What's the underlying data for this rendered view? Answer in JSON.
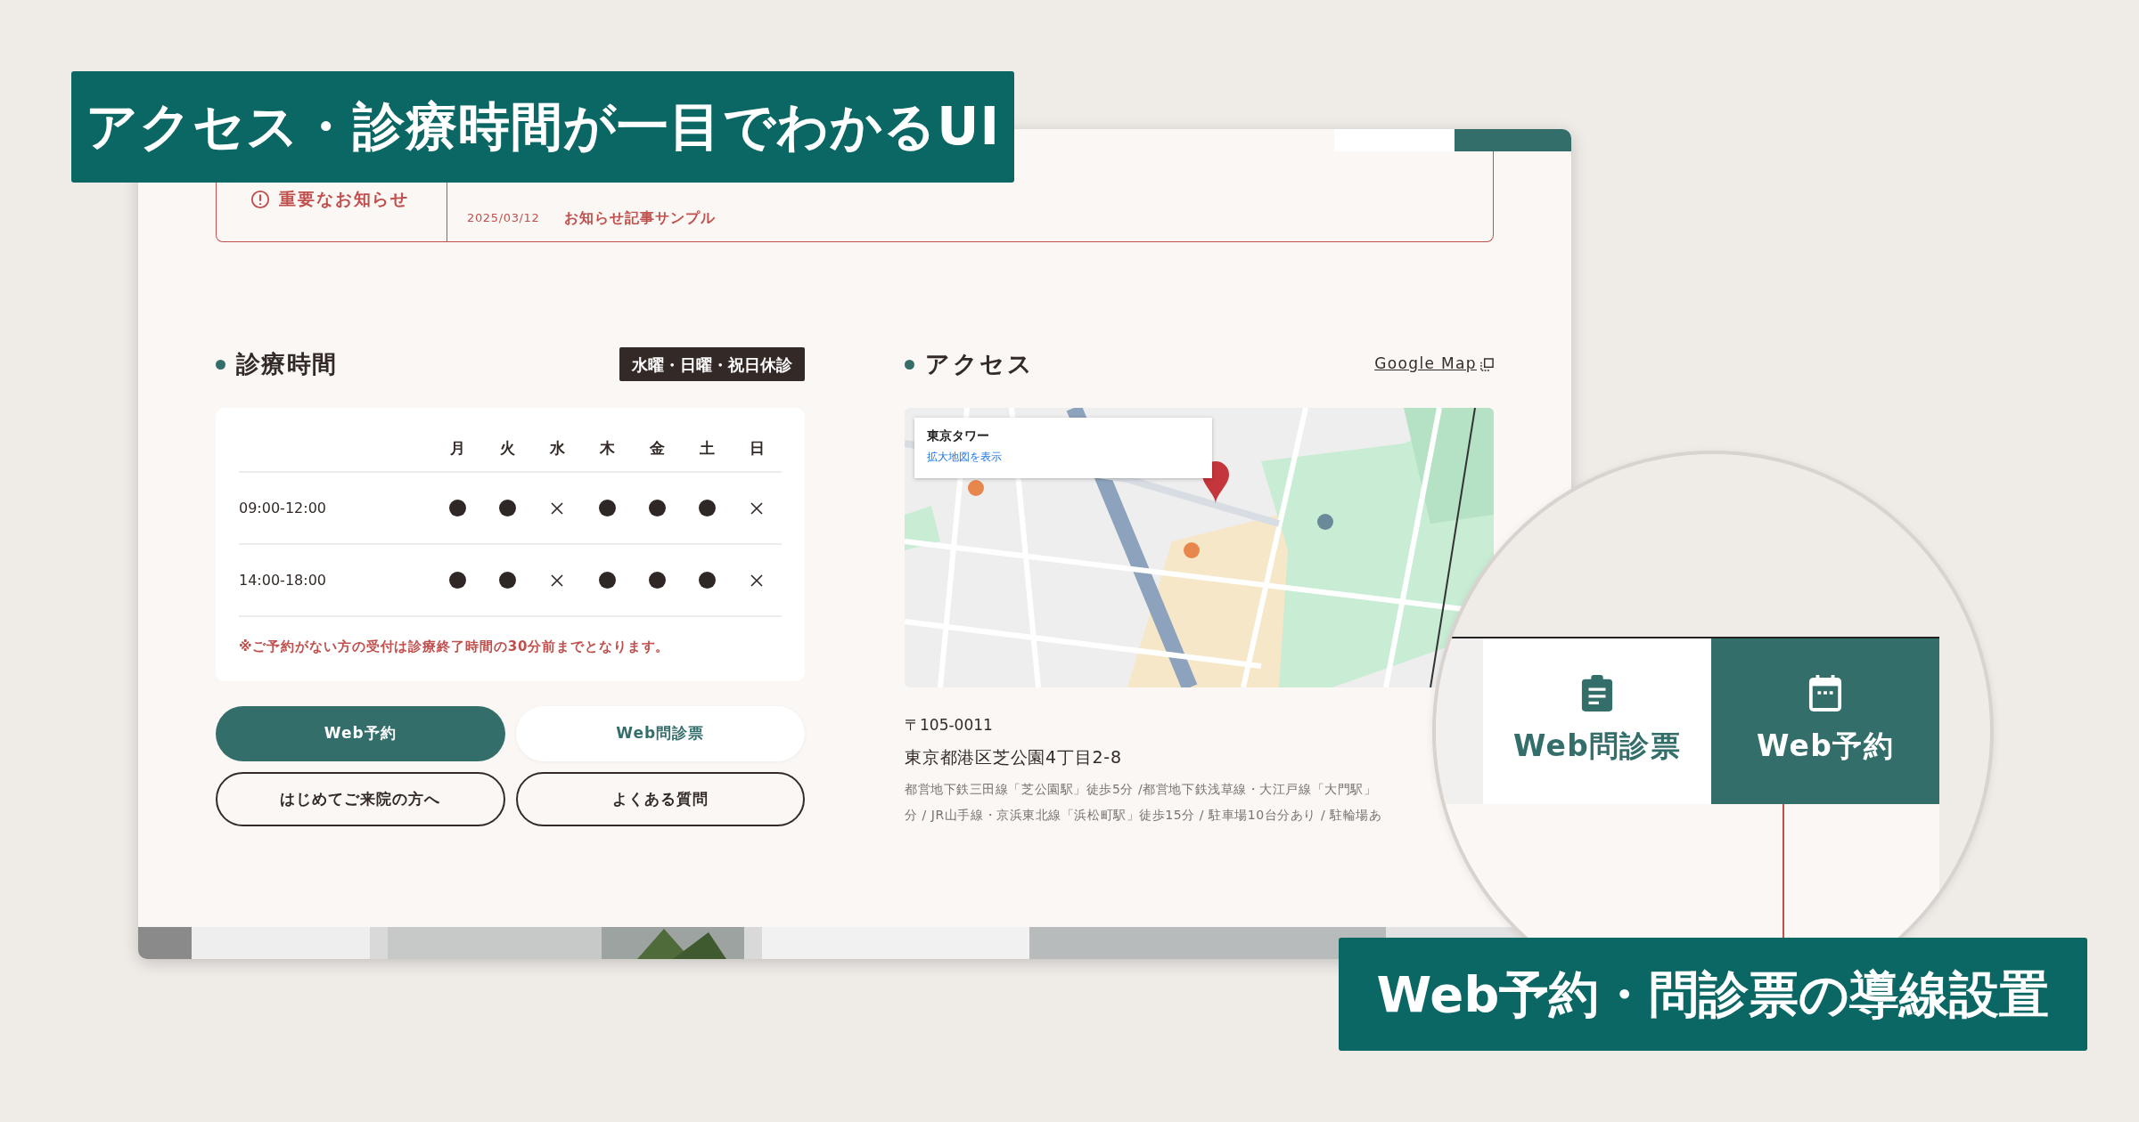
{
  "headline": "アクセス・診療時間が一目でわかるUI",
  "notice": {
    "label": "重要なお知らせ",
    "items": [
      {
        "date": "2025/03/12",
        "title": "お知らせ記事サンプル"
      }
    ]
  },
  "hours": {
    "title": "診療時間",
    "badge": "水曜・日曜・祝日休診",
    "days": [
      "月",
      "火",
      "水",
      "木",
      "金",
      "土",
      "日"
    ],
    "rows": [
      {
        "time": "09:00-12:00",
        "slots": [
          {
            "open": true
          },
          {
            "open": true
          },
          {
            "open": false
          },
          {
            "open": true
          },
          {
            "open": true
          },
          {
            "open": true
          },
          {
            "open": false
          }
        ]
      },
      {
        "time": "14:00-18:00",
        "slots": [
          {
            "open": true
          },
          {
            "open": true
          },
          {
            "open": false
          },
          {
            "open": true
          },
          {
            "open": true
          },
          {
            "open": true
          },
          {
            "open": false
          }
        ]
      }
    ],
    "note": "※ご予約がない方の受付は診療終了時間の30分前までとなります。",
    "buttons": [
      {
        "label": "Web予約",
        "kind": "primary"
      },
      {
        "label": "Web問診票",
        "kind": "light"
      },
      {
        "label": "はじめてご来院の方へ",
        "kind": "outline"
      },
      {
        "label": "よくある質問",
        "kind": "outline"
      }
    ]
  },
  "access": {
    "title": "アクセス",
    "map_link": "Google Map",
    "map": {
      "kind": "picture",
      "place": "東京タワー",
      "link": "拡大地図を表示"
    },
    "postal": "〒105-0011",
    "address": "東京都港区芝公園4丁目2-8",
    "directions": [
      "都営地下鉄三田線「芝公園駅」徒歩5分 /都営地下鉄浅草線・大江戸線「大門駅」",
      "分 / JR山手線・京浜東北線「浜松町駅」徒歩15分 / 駐車場10台分あり / 駐輪場あ"
    ]
  },
  "zoom": {
    "buttons": [
      {
        "label": "Web問診票",
        "kind": "light"
      },
      {
        "label": "Web予約",
        "kind": "primary"
      }
    ]
  },
  "callout": "Web予約・問診票の導線設置"
}
